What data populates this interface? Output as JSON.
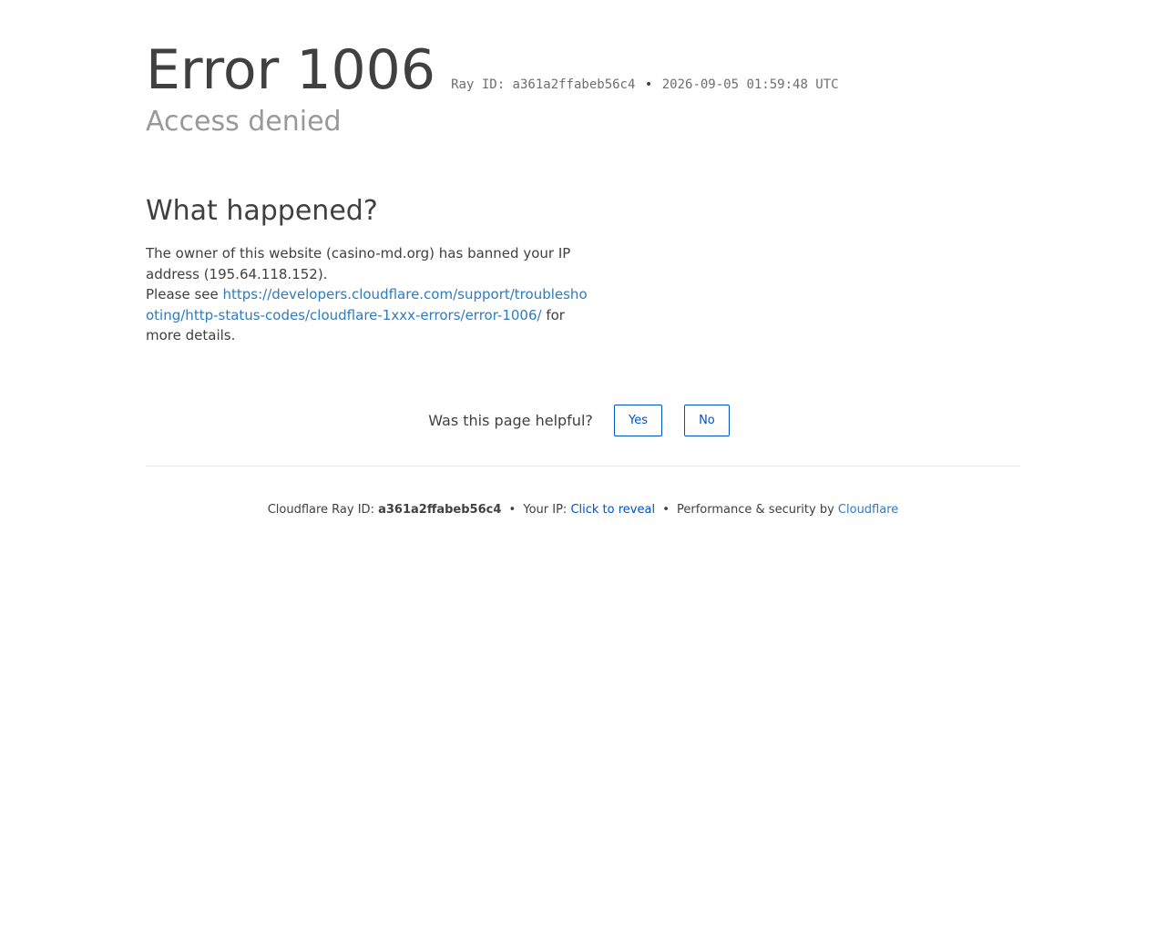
{
  "header": {
    "error_code": "Error 1006",
    "ray_label": "Ray ID: a361a2ffabeb56c4",
    "bullet": "•",
    "timestamp": "2026-09-05 01:59:48 UTC",
    "subtitle": "Access denied"
  },
  "what_happened": {
    "heading": "What happened?",
    "text_1": "The owner of this website (casino-md.org) has banned your IP address (195.64.118.152).",
    "text_2": "Please see",
    "link": "https://developers.cloudflare.com/support/troubleshooting/http-status-codes/cloudflare-1xxx-errors/error-1006/",
    "text_3": "for more details."
  },
  "feedback": {
    "question": "Was this page helpful?",
    "yes_label": "Yes",
    "no_label": "No"
  },
  "footer": {
    "ray_prefix": "Cloudflare Ray ID:",
    "ray_id": "a361a2ffabeb56c4",
    "bullet": "•",
    "ip_prefix": "Your IP:",
    "reveal_label": "Click to reveal",
    "perf_text": "Performance & security by",
    "brand": "Cloudflare"
  },
  "colors": {
    "link": "#2f7bbf",
    "button": "#0051c3",
    "subtitle": "#999999",
    "text": "#404040"
  }
}
